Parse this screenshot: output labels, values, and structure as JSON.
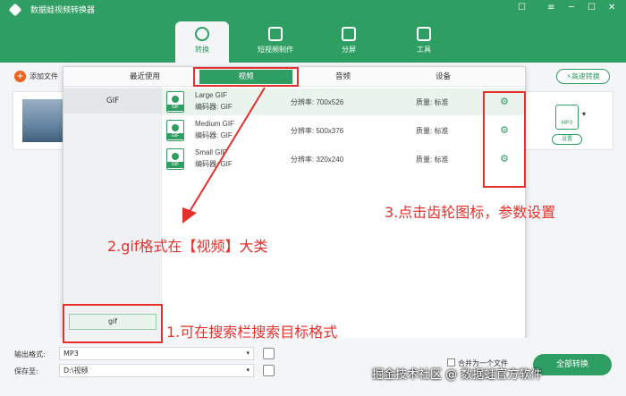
{
  "app": {
    "title": "数据蛙视频转换器"
  },
  "window_controls": {
    "feedback": "☐",
    "menu": "≡",
    "minimize": "─",
    "maximize": "☐",
    "close": "✕"
  },
  "nav": {
    "tabs": [
      {
        "label": "转换",
        "active": true
      },
      {
        "label": "短视频制作"
      },
      {
        "label": "分屏"
      },
      {
        "label": "工具"
      }
    ]
  },
  "toolbar": {
    "add_file": "添加文件",
    "fast_convert": "高速转换"
  },
  "file_card": {
    "format_badge": "MP3",
    "settings_label": "设置"
  },
  "format_popup": {
    "tabs": [
      "最近使用",
      "视频",
      "音频",
      "设备"
    ],
    "active_tab": "视频",
    "categories": [
      "GIF"
    ],
    "search_value": "gif",
    "formats": [
      {
        "icon_label": "GIF",
        "name": "Large GIF",
        "encoder": "编码器:  GIF",
        "resolution": "分辨率:   700x526",
        "quality": "质量:   标准"
      },
      {
        "icon_label": "GIF",
        "name": "Medium GIF",
        "encoder": "编码器:  GIF",
        "resolution": "分辨率:   500x376",
        "quality": "质量:   标准"
      },
      {
        "icon_label": "GIF",
        "name": "Small GIF",
        "encoder": "编码器:  GIF",
        "resolution": "分辨率:   320x240",
        "quality": "质量:   标准"
      }
    ]
  },
  "bottom": {
    "output_format_label": "输出格式:",
    "output_format_value": "MP3",
    "save_to_label": "保存至:",
    "save_to_value": "D:\\视频",
    "merge_label": "合并为一个文件",
    "convert_all": "全部转换"
  },
  "annotations": {
    "step1": "1.可在搜索栏搜索目标格式",
    "step2": "2.gif格式在【视频】大类",
    "step3": "3.点击齿轮图标，参数设置"
  },
  "watermark": "掘金技术社区 @ 数据蛙官方软件",
  "colors": {
    "brand_green": "#2e9e63",
    "annotation_red": "#e5302b",
    "add_orange": "#f2611c"
  },
  "icons": {
    "gear": "⚙",
    "caret": "▾"
  }
}
